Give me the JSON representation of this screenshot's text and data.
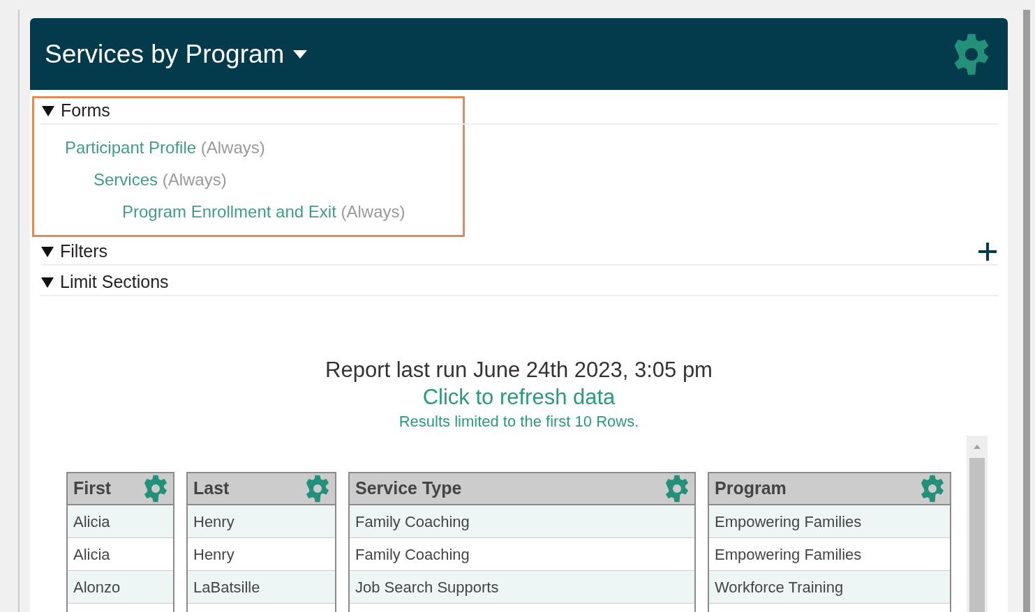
{
  "report": {
    "title": "Services by Program",
    "sections": [
      {
        "label": "Forms",
        "expanded": true,
        "highlighted": true,
        "add_button": false,
        "children": [
          {
            "name": "Participant Profile",
            "qualifier": "(Always)",
            "children": [
              {
                "name": "Services",
                "qualifier": "(Always)",
                "children": [
                  {
                    "name": "Program Enrollment and Exit",
                    "qualifier": "(Always)"
                  }
                ]
              }
            ]
          }
        ]
      },
      {
        "label": "Filters",
        "expanded": true,
        "highlighted": false,
        "add_button": true
      },
      {
        "label": "Limit Sections",
        "expanded": true,
        "highlighted": false,
        "add_button": false
      }
    ],
    "last_run": "Report last run June 24th 2023, 3:05 pm",
    "refresh_link": "Click to refresh data",
    "limit_note": "Results limited to the first 10 Rows.",
    "table": {
      "columns": [
        {
          "label": "First"
        },
        {
          "label": "Last"
        },
        {
          "label": "Service Type"
        },
        {
          "label": "Program"
        }
      ],
      "rows": [
        [
          "Alicia",
          "Henry",
          "Family Coaching",
          "Empowering Families"
        ],
        [
          "Alicia",
          "Henry",
          "Family Coaching",
          "Empowering Families"
        ],
        [
          "Alonzo",
          "LaBatsille",
          "Job Search Supports",
          "Workforce Training"
        ]
      ]
    }
  }
}
